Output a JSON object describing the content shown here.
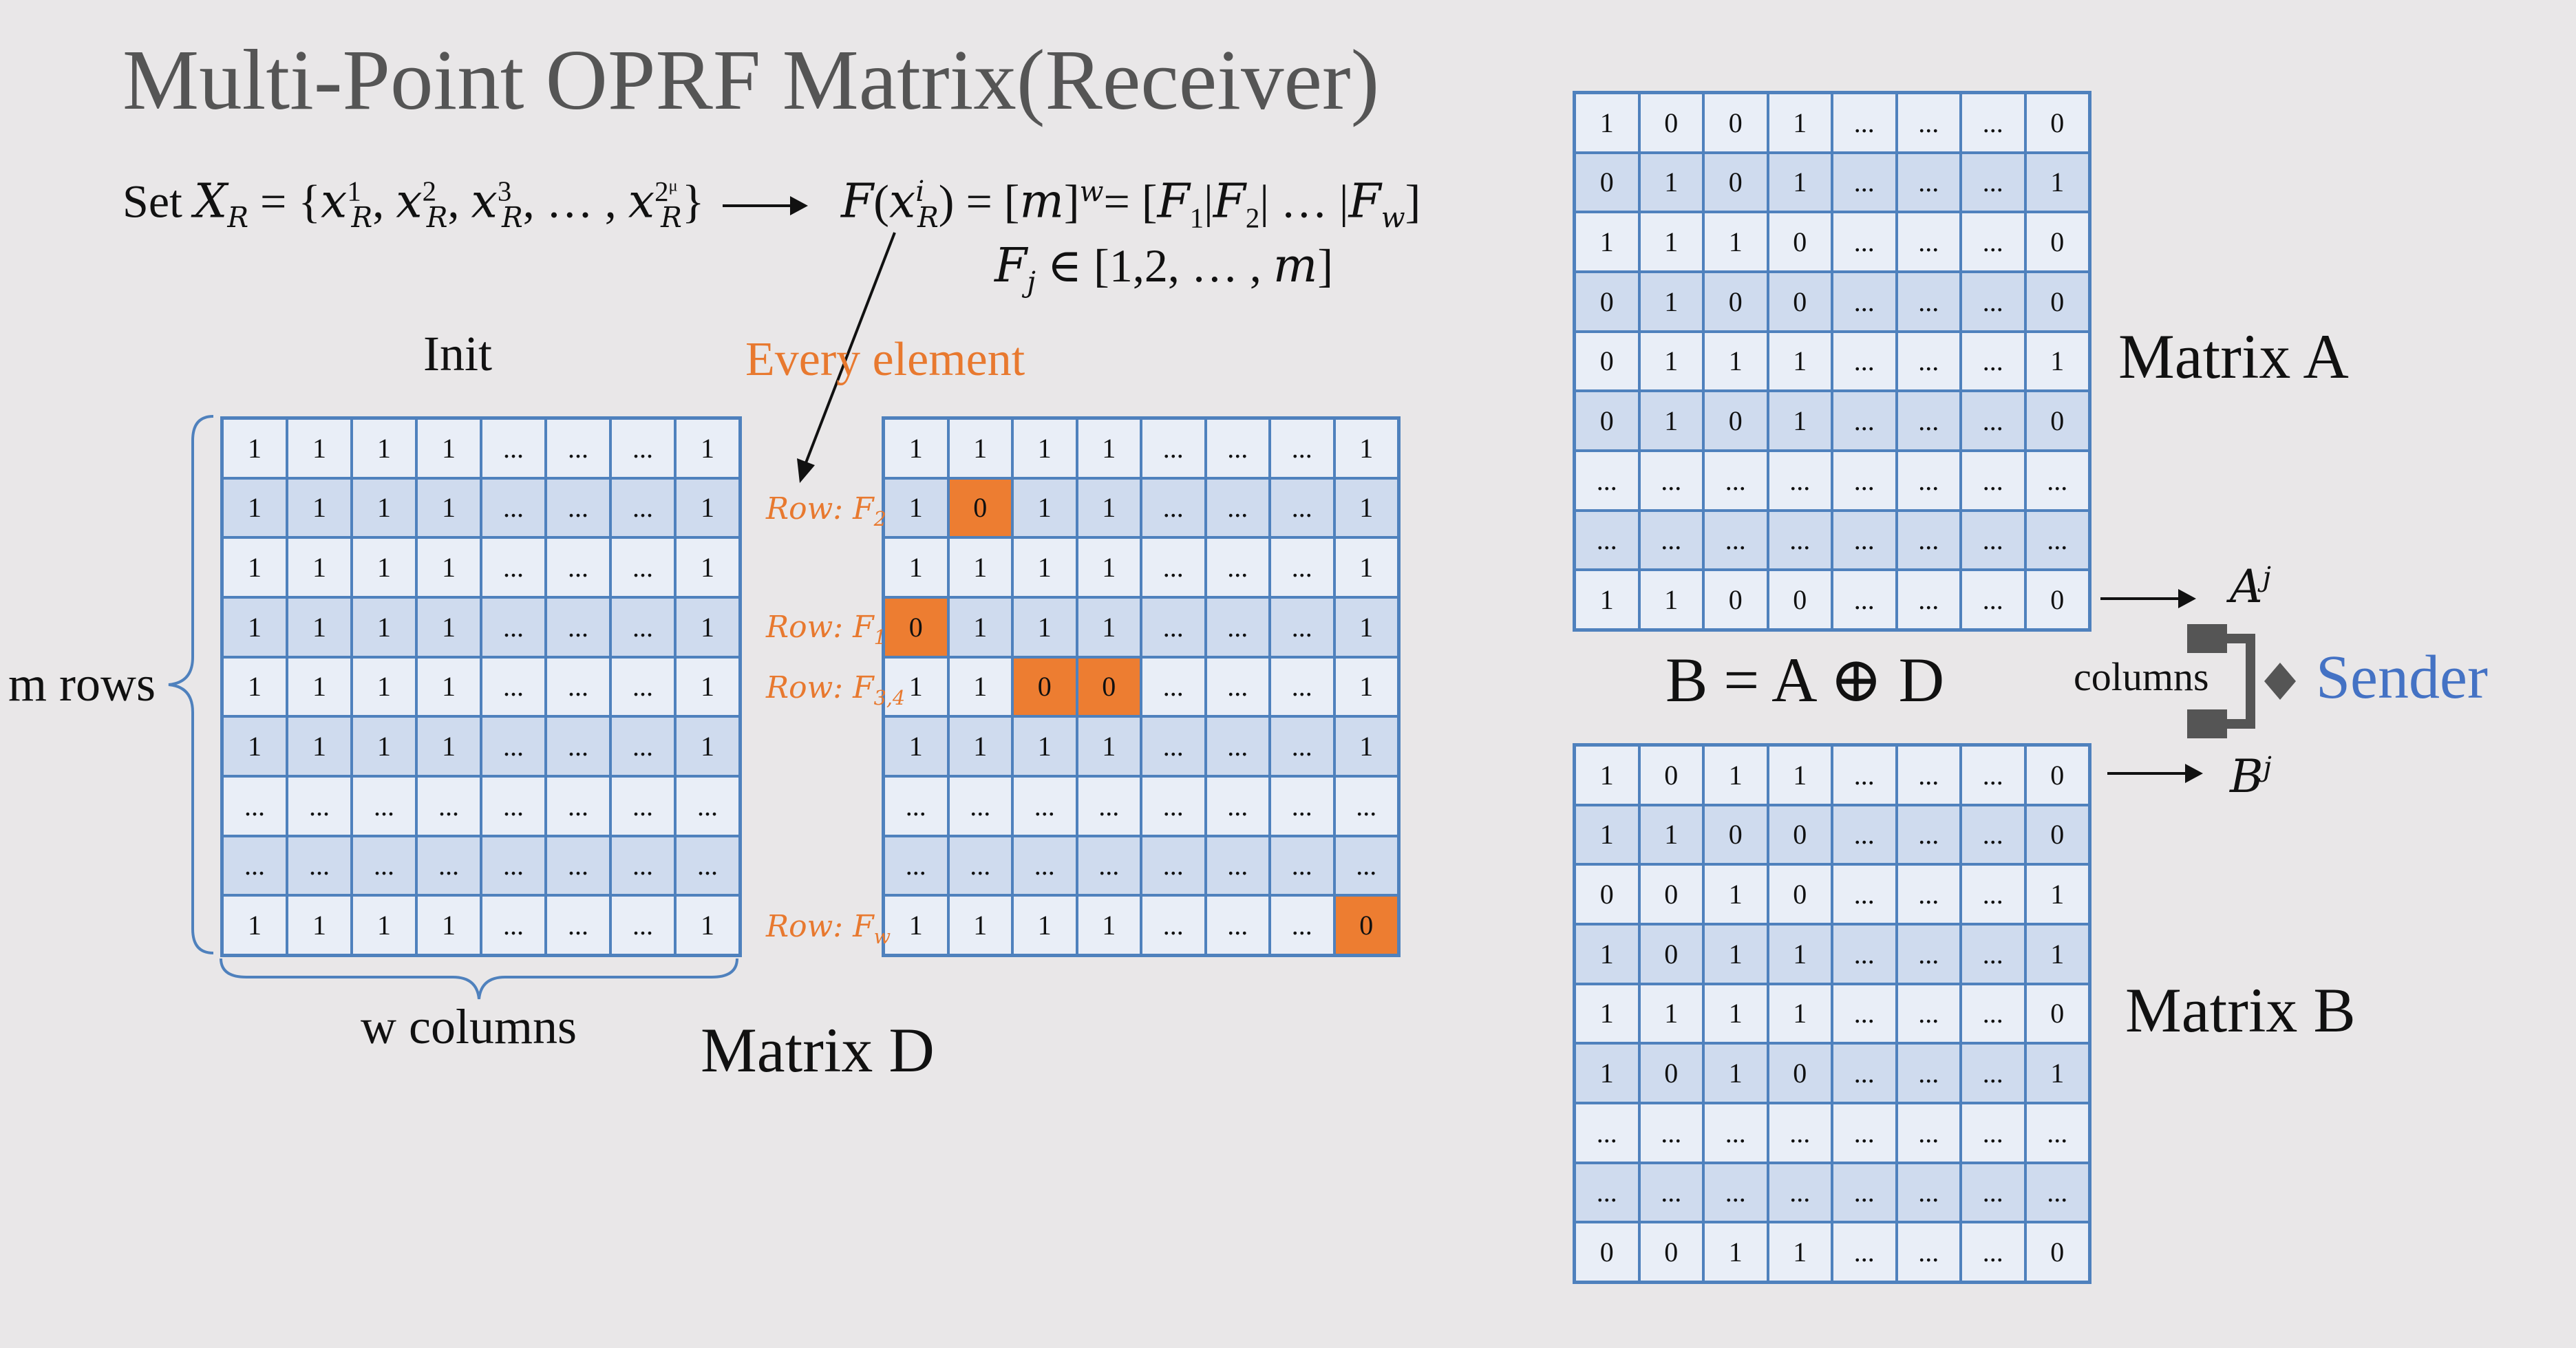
{
  "title": "Multi-Point OPRF Matrix(Receiver)",
  "formulas": {
    "set_prefix": "Set",
    "f_text": "F(x",
    "fj_text": "F"
  },
  "labels": {
    "init": "Init",
    "every_element": "Every element",
    "m_rows": "m rows",
    "w_columns": "w columns",
    "matrix_d": "Matrix D",
    "matrix_a": "Matrix A",
    "matrix_b": "Matrix B",
    "equation": "B = A ⊕ D",
    "columns": "columns",
    "sender": "Sender"
  },
  "row_labels": [
    "Row: F2",
    "Row: F1",
    "Row: F3,4",
    "Row: Fw"
  ],
  "colors": {
    "highlight": "#ed7d31",
    "grid_border": "#4f81bd",
    "sender": "#4472c4",
    "accent_text": "#e8792f"
  },
  "matrices": {
    "init": [
      [
        "1",
        "1",
        "1",
        "1",
        "...",
        "...",
        "...",
        "1"
      ],
      [
        "1",
        "1",
        "1",
        "1",
        "...",
        "...",
        "...",
        "1"
      ],
      [
        "1",
        "1",
        "1",
        "1",
        "...",
        "...",
        "...",
        "1"
      ],
      [
        "1",
        "1",
        "1",
        "1",
        "...",
        "...",
        "...",
        "1"
      ],
      [
        "1",
        "1",
        "1",
        "1",
        "...",
        "...",
        "...",
        "1"
      ],
      [
        "1",
        "1",
        "1",
        "1",
        "...",
        "...",
        "...",
        "1"
      ],
      [
        "...",
        "...",
        "...",
        "...",
        "...",
        "...",
        "...",
        "..."
      ],
      [
        "...",
        "...",
        "...",
        "...",
        "...",
        "...",
        "...",
        "..."
      ],
      [
        "1",
        "1",
        "1",
        "1",
        "...",
        "...",
        "...",
        "1"
      ]
    ],
    "d": [
      [
        "1",
        "1",
        "1",
        "1",
        "...",
        "...",
        "...",
        "1"
      ],
      [
        "1",
        "0",
        "1",
        "1",
        "...",
        "...",
        "...",
        "1"
      ],
      [
        "1",
        "1",
        "1",
        "1",
        "...",
        "...",
        "...",
        "1"
      ],
      [
        "0",
        "1",
        "1",
        "1",
        "...",
        "...",
        "...",
        "1"
      ],
      [
        "1",
        "1",
        "0",
        "0",
        "...",
        "...",
        "...",
        "1"
      ],
      [
        "1",
        "1",
        "1",
        "1",
        "...",
        "...",
        "...",
        "1"
      ],
      [
        "...",
        "...",
        "...",
        "...",
        "...",
        "...",
        "...",
        "..."
      ],
      [
        "...",
        "...",
        "...",
        "...",
        "...",
        "...",
        "...",
        "..."
      ],
      [
        "1",
        "1",
        "1",
        "1",
        "...",
        "...",
        "...",
        "0"
      ]
    ],
    "d_highlights": [
      [
        1,
        1
      ],
      [
        3,
        0
      ],
      [
        4,
        2
      ],
      [
        4,
        3
      ],
      [
        8,
        7
      ]
    ],
    "a": [
      [
        "1",
        "0",
        "0",
        "1",
        "...",
        "...",
        "...",
        "0"
      ],
      [
        "0",
        "1",
        "0",
        "1",
        "...",
        "...",
        "...",
        "1"
      ],
      [
        "1",
        "1",
        "1",
        "0",
        "...",
        "...",
        "...",
        "0"
      ],
      [
        "0",
        "1",
        "0",
        "0",
        "...",
        "...",
        "...",
        "0"
      ],
      [
        "0",
        "1",
        "1",
        "1",
        "...",
        "...",
        "...",
        "1"
      ],
      [
        "0",
        "1",
        "0",
        "1",
        "...",
        "...",
        "...",
        "0"
      ],
      [
        "...",
        "...",
        "...",
        "...",
        "...",
        "...",
        "...",
        "..."
      ],
      [
        "...",
        "...",
        "...",
        "...",
        "...",
        "...",
        "...",
        "..."
      ],
      [
        "1",
        "1",
        "0",
        "0",
        "...",
        "...",
        "...",
        "0"
      ]
    ],
    "b": [
      [
        "1",
        "0",
        "1",
        "1",
        "...",
        "...",
        "...",
        "0"
      ],
      [
        "1",
        "1",
        "0",
        "0",
        "...",
        "...",
        "...",
        "0"
      ],
      [
        "0",
        "0",
        "1",
        "0",
        "...",
        "...",
        "...",
        "1"
      ],
      [
        "1",
        "0",
        "1",
        "1",
        "...",
        "...",
        "...",
        "1"
      ],
      [
        "1",
        "1",
        "1",
        "1",
        "...",
        "...",
        "...",
        "0"
      ],
      [
        "1",
        "0",
        "1",
        "0",
        "...",
        "...",
        "...",
        "1"
      ],
      [
        "...",
        "...",
        "...",
        "...",
        "...",
        "...",
        "...",
        "..."
      ],
      [
        "...",
        "...",
        "...",
        "...",
        "...",
        "...",
        "...",
        "..."
      ],
      [
        "0",
        "0",
        "1",
        "1",
        "...",
        "...",
        "...",
        "0"
      ]
    ]
  }
}
